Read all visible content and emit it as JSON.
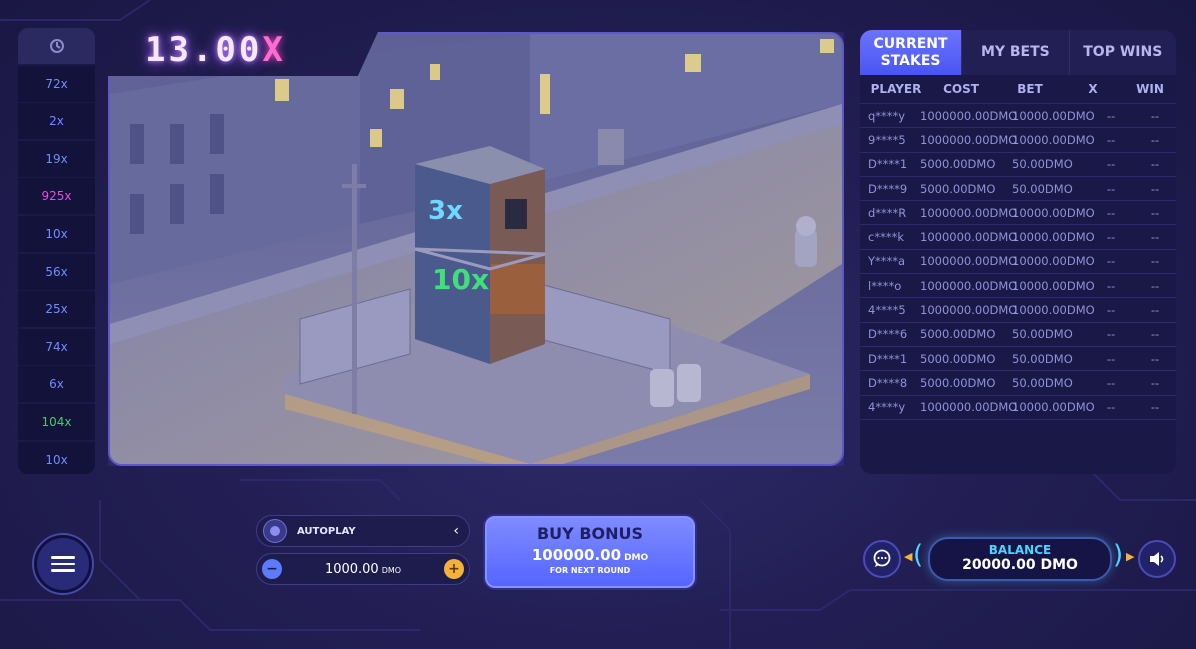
{
  "multiplier": {
    "value": "13.00",
    "suffix": "X"
  },
  "history": {
    "icon": "history-icon",
    "items": [
      {
        "label": "72x",
        "color": "blue"
      },
      {
        "label": "2x",
        "color": "blue"
      },
      {
        "label": "19x",
        "color": "blue"
      },
      {
        "label": "925x",
        "color": "pink"
      },
      {
        "label": "10x",
        "color": "blue"
      },
      {
        "label": "56x",
        "color": "blue"
      },
      {
        "label": "25x",
        "color": "blue"
      },
      {
        "label": "74x",
        "color": "blue"
      },
      {
        "label": "6x",
        "color": "blue"
      },
      {
        "label": "104x",
        "color": "green"
      },
      {
        "label": "10x",
        "color": "blue"
      }
    ]
  },
  "game": {
    "building_labels": [
      "3x",
      "10x"
    ]
  },
  "bets_panel": {
    "tabs": [
      "CURRENT STAKES",
      "MY BETS",
      "TOP WINS"
    ],
    "columns": [
      "PLAYER",
      "COST",
      "BET",
      "X",
      "WIN"
    ],
    "rows": [
      {
        "player": "q****y",
        "cost": "1000000.00DMO",
        "bet": "10000.00DMO",
        "x": "--",
        "win": "--"
      },
      {
        "player": "9****5",
        "cost": "1000000.00DMO",
        "bet": "10000.00DMO",
        "x": "--",
        "win": "--"
      },
      {
        "player": "D****1",
        "cost": "5000.00DMO",
        "bet": "50.00DMO",
        "x": "--",
        "win": "--"
      },
      {
        "player": "D****9",
        "cost": "5000.00DMO",
        "bet": "50.00DMO",
        "x": "--",
        "win": "--"
      },
      {
        "player": "d****R",
        "cost": "1000000.00DMO",
        "bet": "10000.00DMO",
        "x": "--",
        "win": "--"
      },
      {
        "player": "c****k",
        "cost": "1000000.00DMO",
        "bet": "10000.00DMO",
        "x": "--",
        "win": "--"
      },
      {
        "player": "Y****a",
        "cost": "1000000.00DMO",
        "bet": "10000.00DMO",
        "x": "--",
        "win": "--"
      },
      {
        "player": "l****o",
        "cost": "1000000.00DMO",
        "bet": "10000.00DMO",
        "x": "--",
        "win": "--"
      },
      {
        "player": "4****5",
        "cost": "1000000.00DMO",
        "bet": "10000.00DMO",
        "x": "--",
        "win": "--"
      },
      {
        "player": "D****6",
        "cost": "5000.00DMO",
        "bet": "50.00DMO",
        "x": "--",
        "win": "--"
      },
      {
        "player": "D****1",
        "cost": "5000.00DMO",
        "bet": "50.00DMO",
        "x": "--",
        "win": "--"
      },
      {
        "player": "D****8",
        "cost": "5000.00DMO",
        "bet": "50.00DMO",
        "x": "--",
        "win": "--"
      },
      {
        "player": "4****y",
        "cost": "1000000.00DMO",
        "bet": "10000.00DMO",
        "x": "--",
        "win": "--"
      }
    ]
  },
  "controls": {
    "autoplay_label": "AUTOPLAY",
    "stake_amount": "1000.00",
    "stake_currency": "DMO",
    "buy_bonus": {
      "title": "BUY BONUS",
      "amount": "100000.00",
      "currency": "DMO",
      "subtitle": "FOR NEXT ROUND"
    },
    "balance": {
      "label": "BALANCE",
      "value": "20000.00 DMO"
    }
  },
  "colors": {
    "accent": "#5b66ff",
    "history_blue": "#6f8dff",
    "history_pink": "#e84ce5",
    "history_green": "#3cd06a",
    "balance_cyan": "#49d7ff"
  }
}
